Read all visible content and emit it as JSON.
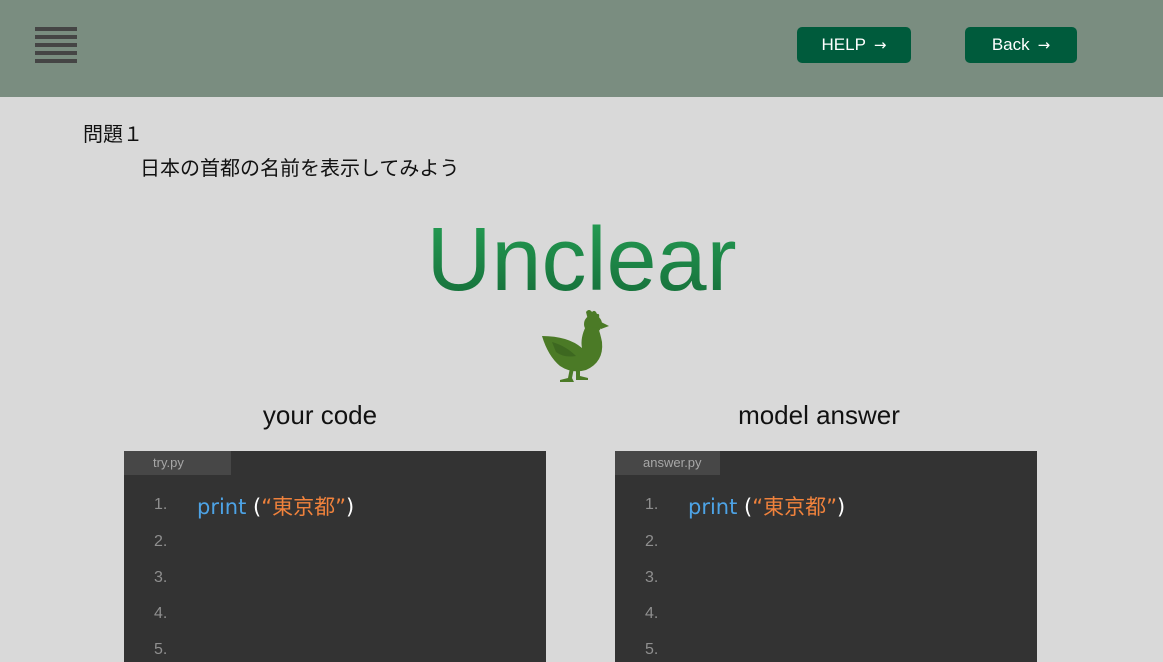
{
  "header": {
    "help_label": "HELP",
    "back_label": "Back",
    "arrow_glyph": "→",
    "menu_icon": "hamburger-menu-icon",
    "background_color": "#7a8d80",
    "button_color": "#005b3c"
  },
  "question": {
    "label": "問題１",
    "text": "日本の首都の名前を表示してみよう"
  },
  "result": {
    "status": "Unclear",
    "color": "#1f8a49",
    "mascot_icon": "bird-mascot-icon"
  },
  "your_code": {
    "title": "your code",
    "filename": "try.py",
    "lines": [
      {
        "num": "1.",
        "keyword": "print",
        "open": " (",
        "string": "“東京都”",
        "close": ")"
      },
      {
        "num": "2.",
        "keyword": "",
        "open": "",
        "string": "",
        "close": ""
      },
      {
        "num": "3.",
        "keyword": "",
        "open": "",
        "string": "",
        "close": ""
      },
      {
        "num": "4.",
        "keyword": "",
        "open": "",
        "string": "",
        "close": ""
      },
      {
        "num": "5.",
        "keyword": "",
        "open": "",
        "string": "",
        "close": ""
      }
    ]
  },
  "model_answer": {
    "title": "model answer",
    "filename": "answer.py",
    "lines": [
      {
        "num": "1.",
        "keyword": "print",
        "open": " (",
        "string": "“東京都”",
        "close": ")"
      },
      {
        "num": "2.",
        "keyword": "",
        "open": "",
        "string": "",
        "close": ""
      },
      {
        "num": "3.",
        "keyword": "",
        "open": "",
        "string": "",
        "close": ""
      },
      {
        "num": "4.",
        "keyword": "",
        "open": "",
        "string": "",
        "close": ""
      },
      {
        "num": "5.",
        "keyword": "",
        "open": "",
        "string": "",
        "close": ""
      }
    ]
  }
}
